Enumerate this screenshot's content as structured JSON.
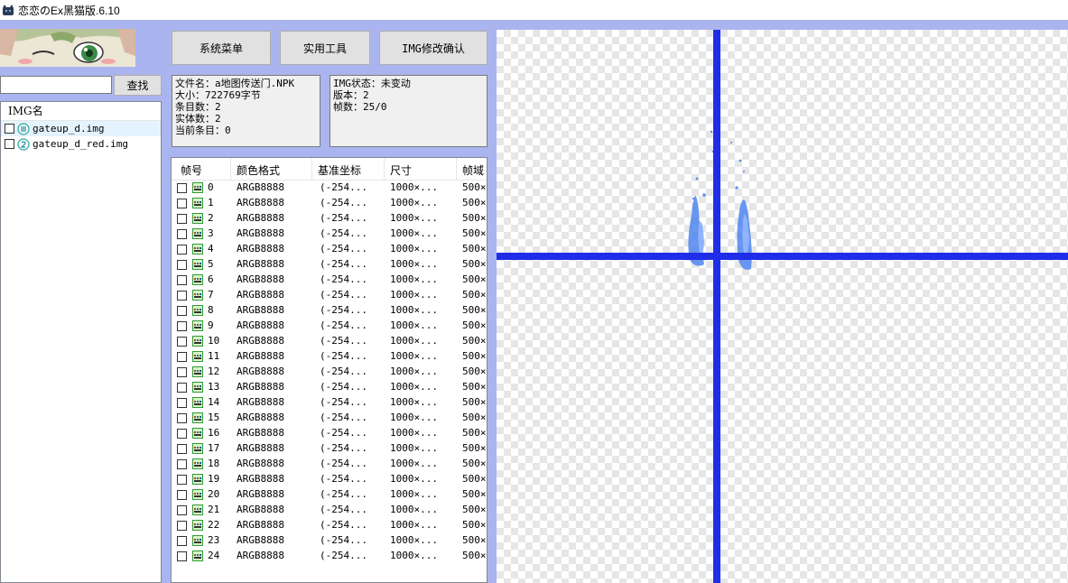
{
  "window": {
    "title": "恋恋のEx黑猫版.6.10"
  },
  "search": {
    "value": "",
    "button_label": "查找"
  },
  "img_list": {
    "header": "IMG名",
    "items": [
      {
        "name": "gateup_d.img",
        "selected": true
      },
      {
        "name": "gateup_d_red.img",
        "selected": false
      }
    ]
  },
  "toolbar": {
    "system_menu": "系统菜单",
    "tools": "实用工具",
    "img_confirm": "IMG修改确认"
  },
  "file_info": {
    "filename": "文件名：a地图传送门.NPK",
    "size": "大小：722769字节",
    "entries": "条目数：2",
    "entities": "实体数：2",
    "current": "当前条目：0"
  },
  "img_info": {
    "status": "IMG状态：未变动",
    "version": "版本：2",
    "frames": "帧数：25/0"
  },
  "frame_table": {
    "columns": [
      "帧号",
      "颜色格式",
      "基准坐标",
      "尺寸",
      "帧域"
    ],
    "rows": [
      [
        "0",
        "ARGB8888",
        "(-254...",
        "1000×...",
        "500×"
      ],
      [
        "1",
        "ARGB8888",
        "(-254...",
        "1000×...",
        "500×"
      ],
      [
        "2",
        "ARGB8888",
        "(-254...",
        "1000×...",
        "500×"
      ],
      [
        "3",
        "ARGB8888",
        "(-254...",
        "1000×...",
        "500×"
      ],
      [
        "4",
        "ARGB8888",
        "(-254...",
        "1000×...",
        "500×"
      ],
      [
        "5",
        "ARGB8888",
        "(-254...",
        "1000×...",
        "500×"
      ],
      [
        "6",
        "ARGB8888",
        "(-254...",
        "1000×...",
        "500×"
      ],
      [
        "7",
        "ARGB8888",
        "(-254...",
        "1000×...",
        "500×"
      ],
      [
        "8",
        "ARGB8888",
        "(-254...",
        "1000×...",
        "500×"
      ],
      [
        "9",
        "ARGB8888",
        "(-254...",
        "1000×...",
        "500×"
      ],
      [
        "10",
        "ARGB8888",
        "(-254...",
        "1000×...",
        "500×"
      ],
      [
        "11",
        "ARGB8888",
        "(-254...",
        "1000×...",
        "500×"
      ],
      [
        "12",
        "ARGB8888",
        "(-254...",
        "1000×...",
        "500×"
      ],
      [
        "13",
        "ARGB8888",
        "(-254...",
        "1000×...",
        "500×"
      ],
      [
        "14",
        "ARGB8888",
        "(-254...",
        "1000×...",
        "500×"
      ],
      [
        "15",
        "ARGB8888",
        "(-254...",
        "1000×...",
        "500×"
      ],
      [
        "16",
        "ARGB8888",
        "(-254...",
        "1000×...",
        "500×"
      ],
      [
        "17",
        "ARGB8888",
        "(-254...",
        "1000×...",
        "500×"
      ],
      [
        "18",
        "ARGB8888",
        "(-254...",
        "1000×...",
        "500×"
      ],
      [
        "19",
        "ARGB8888",
        "(-254...",
        "1000×...",
        "500×"
      ],
      [
        "20",
        "ARGB8888",
        "(-254...",
        "1000×...",
        "500×"
      ],
      [
        "21",
        "ARGB8888",
        "(-254...",
        "1000×...",
        "500×"
      ],
      [
        "22",
        "ARGB8888",
        "(-254...",
        "1000×...",
        "500×"
      ],
      [
        "23",
        "ARGB8888",
        "(-254...",
        "1000×...",
        "500×"
      ],
      [
        "24",
        "ARGB8888",
        "(-254...",
        "1000×...",
        "500×"
      ]
    ]
  },
  "colors": {
    "client_bg": "#aab5ef",
    "axis": "#1f2de8",
    "sprite": "#4f86f0"
  },
  "icons": {
    "app": "black-cat-icon",
    "img_item": "img-file-icon",
    "frame": "frame-image-icon"
  }
}
